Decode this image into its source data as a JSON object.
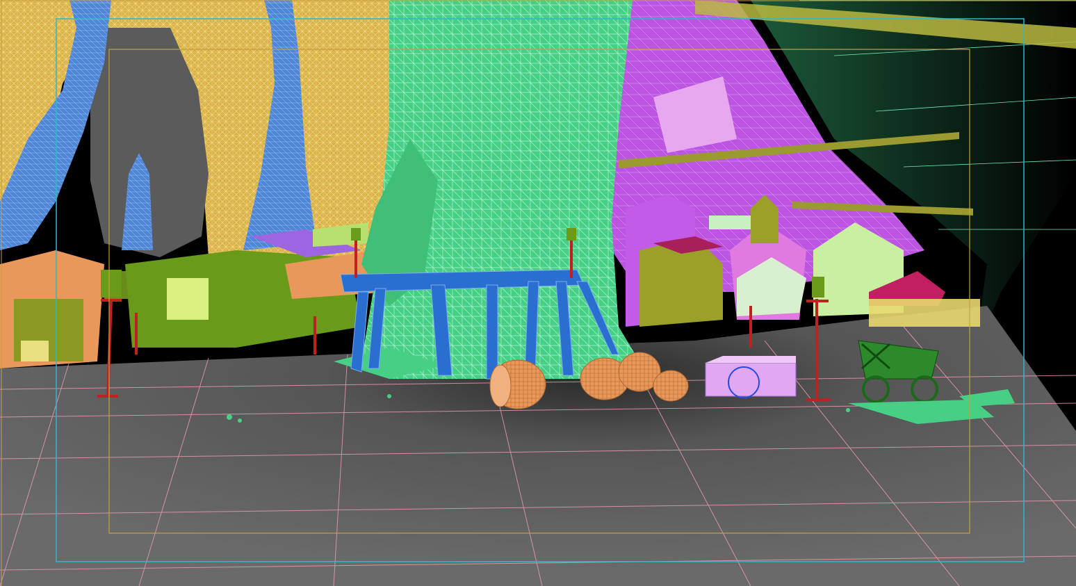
{
  "viewport": {
    "shading_mode": "wireframe-over-shaded",
    "palette": {
      "background": "#000000",
      "ground": "#5e5e5e",
      "ground_grid": "#f0a0b0",
      "cave_wall": "#e8c15a",
      "rock_blue": "#5a8fe0",
      "tree_trunk": "#4fd88f",
      "tree_wire": "#8ff0c0",
      "magenta_cliff": "#c25ce8",
      "barrel": "#e8985a",
      "bench": "#2a6fd0",
      "lamp_post": "#c02020",
      "cart": "#2c8a2c",
      "safe_frame_outer": "#2fb8c8",
      "safe_frame_inner": "#c8a040",
      "bridge": "#b8b840",
      "house_olive": "#8a9a20",
      "house_pink": "#e07ae0"
    }
  },
  "objects": [
    {
      "name": "ground-plane-object"
    },
    {
      "name": "cave-wall-object"
    },
    {
      "name": "rock-spire-left-object"
    },
    {
      "name": "rock-spire-mid-object"
    },
    {
      "name": "tree-trunk-object"
    },
    {
      "name": "magenta-cliff-object"
    },
    {
      "name": "rope-bridge-object"
    },
    {
      "name": "village-houses-object"
    },
    {
      "name": "wooden-bench-object"
    },
    {
      "name": "barrels-object"
    },
    {
      "name": "crate-object"
    },
    {
      "name": "lamp-posts-object"
    },
    {
      "name": "cart-object"
    },
    {
      "name": "safe-frame-outer"
    },
    {
      "name": "safe-frame-inner"
    }
  ]
}
